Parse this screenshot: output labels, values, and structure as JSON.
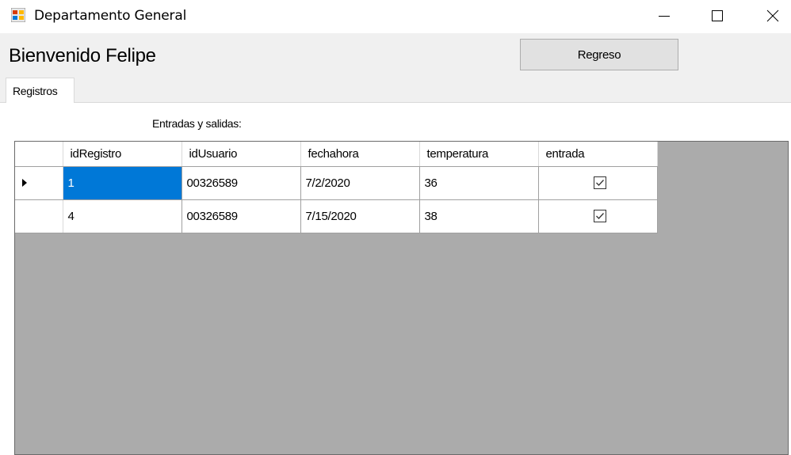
{
  "window": {
    "title": "Departamento General",
    "icon": "windows-forms-app-icon",
    "buttons": [
      "minimize-icon",
      "maximize-icon",
      "close-icon"
    ]
  },
  "header": {
    "welcome_text": "Bienvenido Felipe",
    "back_button_label": "Regreso"
  },
  "tabs": [
    {
      "label": "Registros",
      "selected": true
    }
  ],
  "section": {
    "label": "Entradas y salidas:"
  },
  "grid": {
    "columns": [
      "idRegistro",
      "idUsuario",
      "fechahora",
      "temperatura",
      "entrada"
    ],
    "rows": [
      {
        "idRegistro": "1",
        "idUsuario": "00326589",
        "fechahora": "7/2/2020",
        "temperatura": "36",
        "entrada": true,
        "current": true
      },
      {
        "idRegistro": "4",
        "idUsuario": "00326589",
        "fechahora": "7/15/2020",
        "temperatura": "38",
        "entrada": true,
        "current": false
      }
    ],
    "selection_color": "#0078d7",
    "background_color": "#ababab"
  }
}
